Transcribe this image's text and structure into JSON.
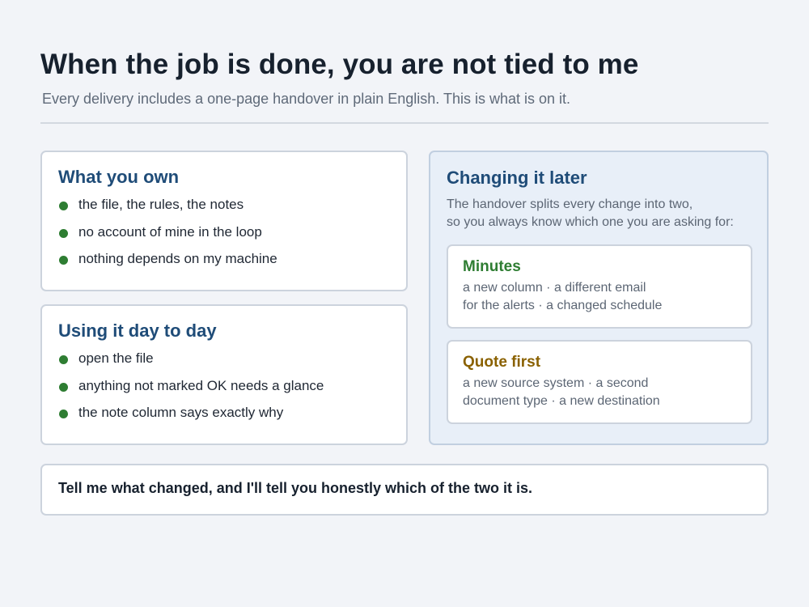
{
  "header": {
    "title": "When the job is done, you are not tied to me",
    "subtitle": "Every delivery includes a one-page handover in plain English. This is what is on it."
  },
  "own": {
    "title": "What you own",
    "items": [
      "the file, the rules, the notes",
      "no account of mine in the loop",
      "nothing depends on my machine"
    ]
  },
  "use": {
    "title": "Using it day to day",
    "items": [
      "open the file",
      "anything not marked OK needs a glance",
      "the note column says exactly why"
    ]
  },
  "change": {
    "title": "Changing it later",
    "intro_lines": [
      "The handover splits every change into two,",
      "so you always know which one you are asking for:"
    ],
    "minutes": {
      "title": "Minutes",
      "lines": [
        "a new column · a different email",
        "for the alerts · a changed schedule"
      ]
    },
    "quote": {
      "title": "Quote first",
      "lines": [
        "a new source system · a second",
        "document type · a new destination"
      ]
    }
  },
  "footer": {
    "text": "Tell me what changed, and I'll tell you honestly which of the two it is."
  },
  "colors": {
    "background": "#f2f4f8",
    "card_title": "#1f4c78",
    "bullet": "#2e7d32",
    "minutes": "#2e7d32",
    "quote_first": "#8a6100",
    "highlight_card": "#e8eff8"
  }
}
